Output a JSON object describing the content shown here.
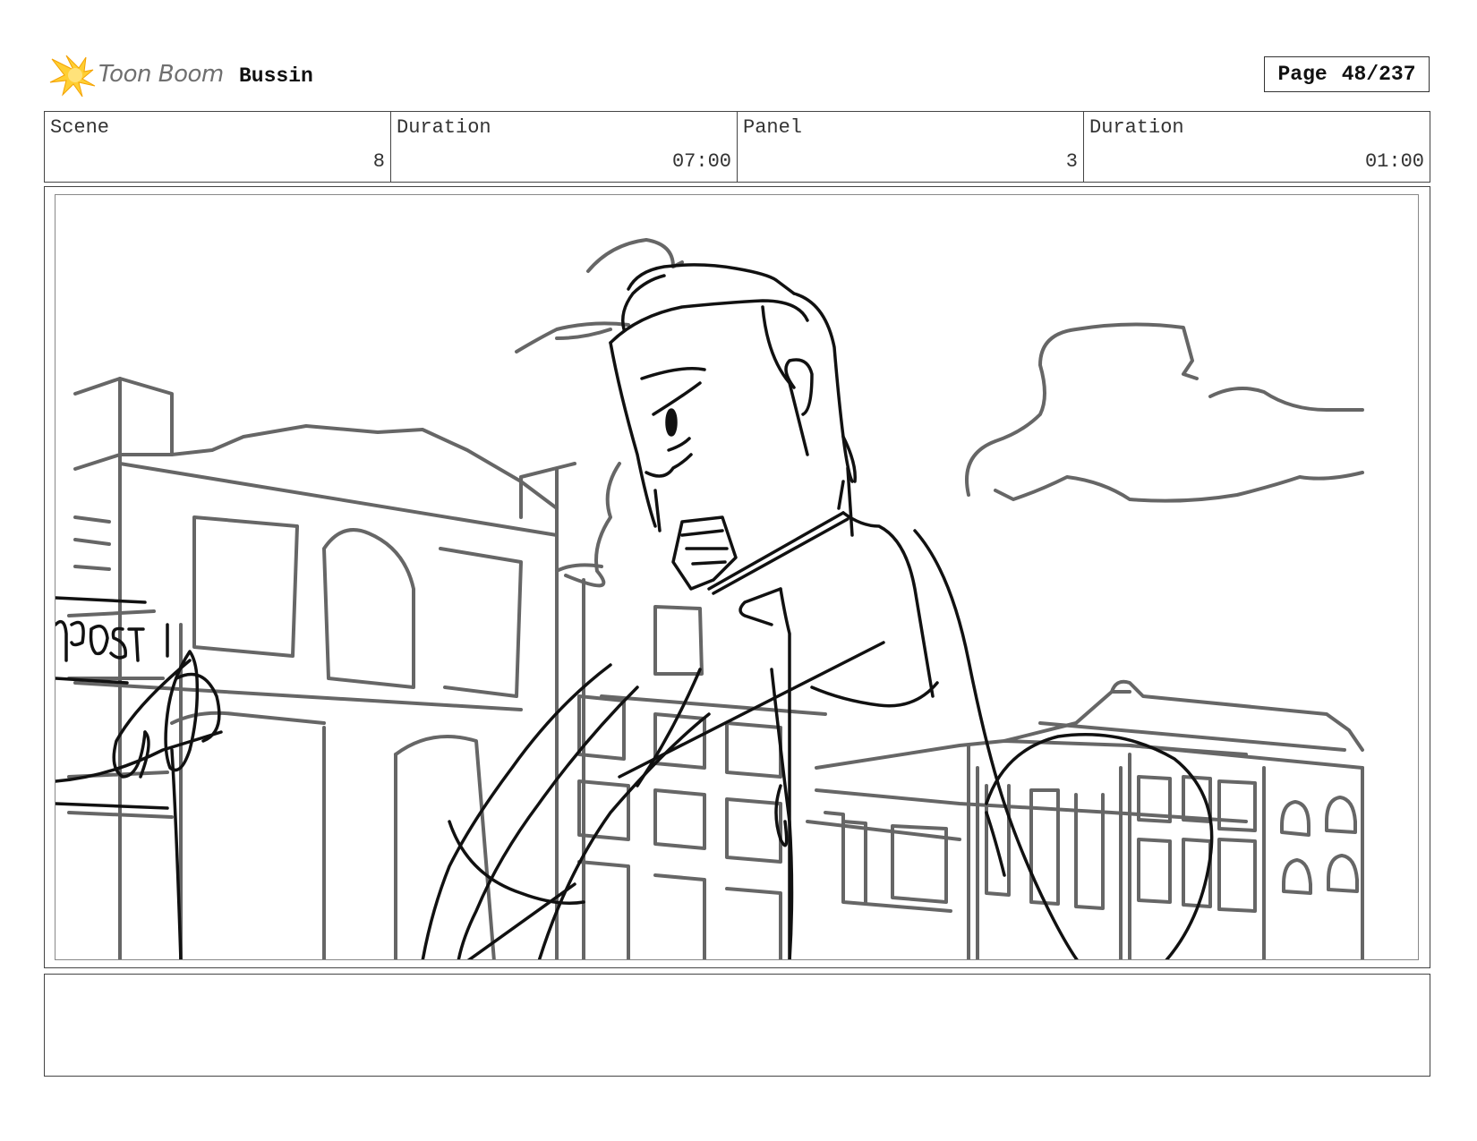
{
  "header": {
    "logo_text": "Toon Boom",
    "project_title": "Bussin",
    "page_label": "Page",
    "page_number": "48/237"
  },
  "info": {
    "scene_label": "Scene",
    "scene_value": "8",
    "scene_duration_label": "Duration",
    "scene_duration_value": "07:00",
    "panel_label": "Panel",
    "panel_value": "3",
    "panel_duration_label": "Duration",
    "panel_duration_value": "01:00"
  },
  "panel_drawing": {
    "sign_text": "POST"
  },
  "notes": {
    "text": ""
  },
  "colors": {
    "logo_orange": "#f5a623",
    "logo_yellow": "#ffd23f",
    "sketch_gray": "#666666",
    "sketch_black": "#111111"
  }
}
